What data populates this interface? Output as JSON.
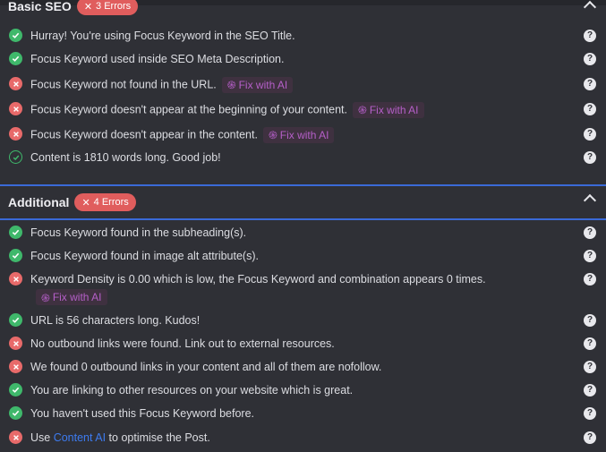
{
  "basic_seo": {
    "title": "Basic SEO",
    "badge": "3 Errors",
    "items": [
      {
        "status": "ok",
        "text": "Hurray! You're using Focus Keyword in the SEO Title."
      },
      {
        "status": "ok",
        "text": "Focus Keyword used inside SEO Meta Description."
      },
      {
        "status": "error",
        "text": "Focus Keyword not found in the URL.",
        "fix": "Fix with AI"
      },
      {
        "status": "error",
        "text": "Focus Keyword doesn't appear at the beginning of your content.",
        "fix": "Fix with AI"
      },
      {
        "status": "error",
        "text": "Focus Keyword doesn't appear in the content.",
        "fix": "Fix with AI"
      },
      {
        "status": "ok-outline",
        "text": "Content is 1810 words long. Good job!"
      }
    ]
  },
  "additional": {
    "title": "Additional",
    "badge": "4 Errors",
    "items": [
      {
        "status": "ok",
        "text": "Focus Keyword found in the subheading(s)."
      },
      {
        "status": "ok",
        "text": "Focus Keyword found in image alt attribute(s)."
      },
      {
        "status": "error",
        "text": "Keyword Density is 0.00 which is low, the Focus Keyword and combination appears 0 times.",
        "fix": "Fix with AI"
      },
      {
        "status": "ok",
        "text": "URL is 56 characters long. Kudos!"
      },
      {
        "status": "error",
        "text": "No outbound links were found. Link out to external resources."
      },
      {
        "status": "error",
        "text": "We found 0 outbound links in your content and all of them are nofollow."
      },
      {
        "status": "ok",
        "text": "You are linking to other resources on your website which is great."
      },
      {
        "status": "ok",
        "text": "You haven't used this Focus Keyword before."
      },
      {
        "status": "error",
        "text_before": "Use ",
        "link": "Content AI",
        "text_after": " to optimise the Post."
      }
    ]
  },
  "help_label": "?",
  "colors": {
    "ok": "#3fb86b",
    "error": "#e86a6a",
    "badge": "#e05d5d",
    "fix_text": "#b55fc8",
    "link": "#3d7bf0",
    "divider": "#3a6ad8"
  }
}
